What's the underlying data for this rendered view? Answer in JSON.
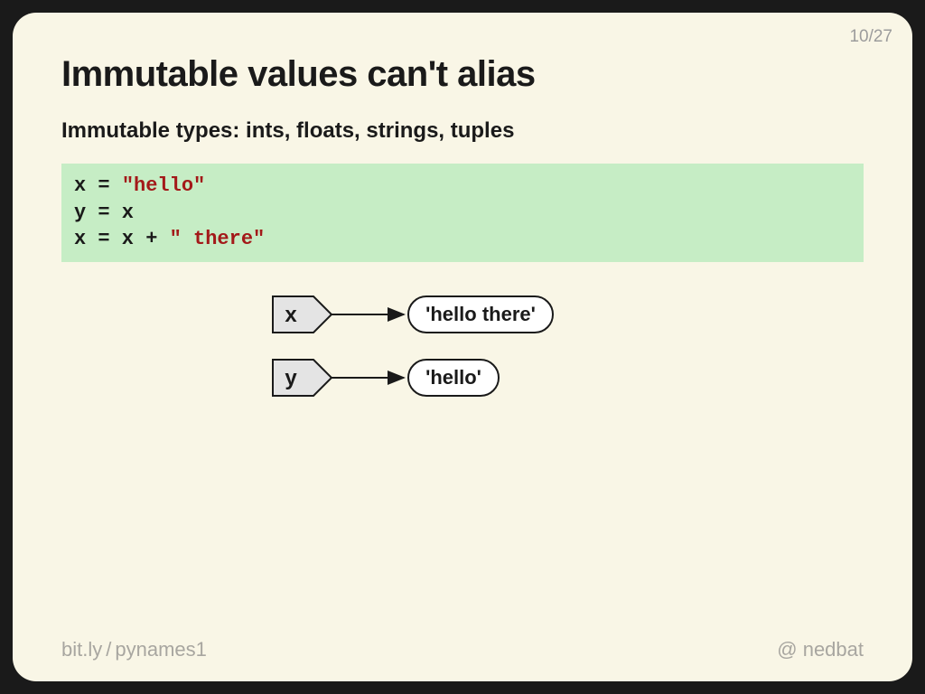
{
  "page": {
    "current": "10",
    "sep": "/",
    "total": "27"
  },
  "title": "Immutable values can't alias",
  "subtitle": "Immutable types: ints, floats, strings, tuples",
  "code": {
    "l1a": "x = ",
    "l1b": "\"hello\"",
    "l2": "y = x",
    "l3a": "x = x + ",
    "l3b": "\" there\""
  },
  "diagram": {
    "tag1": "x",
    "val1": "'hello there'",
    "tag2": "y",
    "val2": "'hello'"
  },
  "footer": {
    "link_host": "bit.ly",
    "slash": "/",
    "link_path": "pynames1",
    "at": "@",
    "handle": "nedbat"
  }
}
